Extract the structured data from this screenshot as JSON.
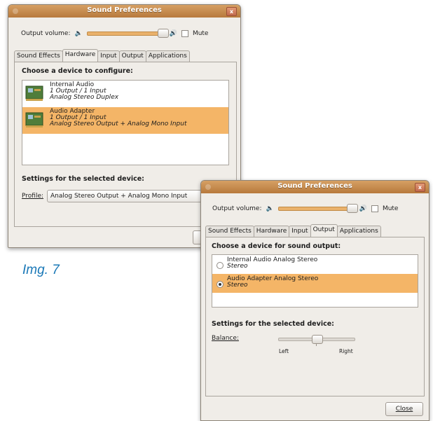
{
  "caption": "Img. 7",
  "window_hw": {
    "title": "Sound Preferences",
    "close": "x",
    "volume_label": "Output volume:",
    "volume_fraction": 0.9,
    "mute_label": "Mute",
    "tabs": [
      "Sound Effects",
      "Hardware",
      "Input",
      "Output",
      "Applications"
    ],
    "active_tab": "Hardware",
    "choose_title": "Choose a device to configure:",
    "devices": [
      {
        "name": "Internal Audio",
        "io": "1 Output / 1 Input",
        "profile": "Analog Stereo Duplex"
      },
      {
        "name": "Audio Adapter",
        "io": "1 Output / 1 Input",
        "profile": "Analog Stereo Output + Analog Mono Input"
      }
    ],
    "selected_device": "Audio Adapter",
    "settings_title": "Settings for the selected device:",
    "profile_label": "Profile:",
    "profile_value": "Analog Stereo Output + Analog Mono Input"
  },
  "window_out": {
    "title": "Sound Preferences",
    "close": "x",
    "volume_label": "Output volume:",
    "volume_fraction": 0.9,
    "mute_label": "Mute",
    "tabs": [
      "Sound Effects",
      "Hardware",
      "Input",
      "Output",
      "Applications"
    ],
    "active_tab": "Output",
    "choose_title": "Choose a device for sound output:",
    "outputs": [
      {
        "name": "Internal Audio Analog Stereo",
        "mode": "Stereo",
        "selected": false
      },
      {
        "name": "Audio Adapter Analog Stereo",
        "mode": "Stereo",
        "selected": true
      }
    ],
    "settings_title": "Settings for the selected device:",
    "balance_label": "Balance:",
    "balance_value": 0.5,
    "left_label": "Left",
    "right_label": "Right",
    "close_button": "Close"
  }
}
